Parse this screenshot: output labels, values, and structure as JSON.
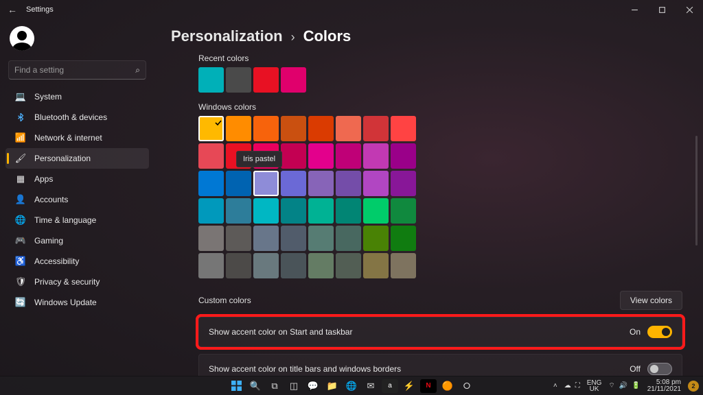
{
  "window": {
    "title": "Settings",
    "controls": {
      "min": "minimize",
      "max": "maximize",
      "close": "close"
    }
  },
  "profile": {
    "name": "",
    "email": ""
  },
  "search": {
    "placeholder": "Find a setting"
  },
  "sidebar": {
    "items": [
      {
        "label": "System",
        "icon": "💻"
      },
      {
        "label": "Bluetooth & devices",
        "icon": "ble"
      },
      {
        "label": "Network & internet",
        "icon": "📶"
      },
      {
        "label": "Personalization",
        "icon": "🖌"
      },
      {
        "label": "Apps",
        "icon": "▦"
      },
      {
        "label": "Accounts",
        "icon": "👤"
      },
      {
        "label": "Time & language",
        "icon": "🌐"
      },
      {
        "label": "Gaming",
        "icon": "🎮"
      },
      {
        "label": "Accessibility",
        "icon": "♿"
      },
      {
        "label": "Privacy & security",
        "icon": "🛡"
      },
      {
        "label": "Windows Update",
        "icon": "🔄"
      }
    ],
    "active_index": 3
  },
  "breadcrumb": {
    "parent": "Personalization",
    "sep": "›",
    "current": "Colors"
  },
  "sections": {
    "recent_label": "Recent colors",
    "recent_colors": [
      "#00b0b8",
      "#4a4a4a",
      "#e81123",
      "#e0006c"
    ],
    "windows_label": "Windows colors",
    "windows_colors": [
      "#ffb900",
      "#ff8c00",
      "#f7630c",
      "#ca5010",
      "#da3b01",
      "#ef6950",
      "#d13438",
      "#ff4343",
      "#e74856",
      "#e81123",
      "#ea005e",
      "#c30052",
      "#e3008c",
      "#bf0077",
      "#c239b3",
      "#9a0089",
      "#0078d4",
      "#0063b1",
      "#8e8cd8",
      "#6b69d6",
      "#8764b8",
      "#744da9",
      "#b146c2",
      "#881798",
      "#0099bc",
      "#2d7d9a",
      "#00b7c3",
      "#038387",
      "#00b294",
      "#018574",
      "#00cc6a",
      "#10893e",
      "#7a7574",
      "#5d5a58",
      "#68768a",
      "#515c6b",
      "#567c73",
      "#486860",
      "#498205",
      "#107c10",
      "#767676",
      "#4c4a48",
      "#69797e",
      "#4a5459",
      "#647c64",
      "#525e54",
      "#847545",
      "#7e735f"
    ],
    "windows_selected_index": 0,
    "hovered_index": 18,
    "tooltip_text": "Iris pastel",
    "custom_label": "Custom colors",
    "view_colors_label": "View colors",
    "setting_accent_start": {
      "label": "Show accent color on Start and taskbar",
      "state_text": "On",
      "on": true
    },
    "setting_accent_title": {
      "label": "Show accent color on title bars and windows borders",
      "state_text": "Off",
      "on": false
    }
  },
  "taskbar": {
    "lang1": "ENG",
    "lang2": "UK",
    "time": "5:08 pm",
    "date": "21/11/2021",
    "notif_count": "2"
  }
}
